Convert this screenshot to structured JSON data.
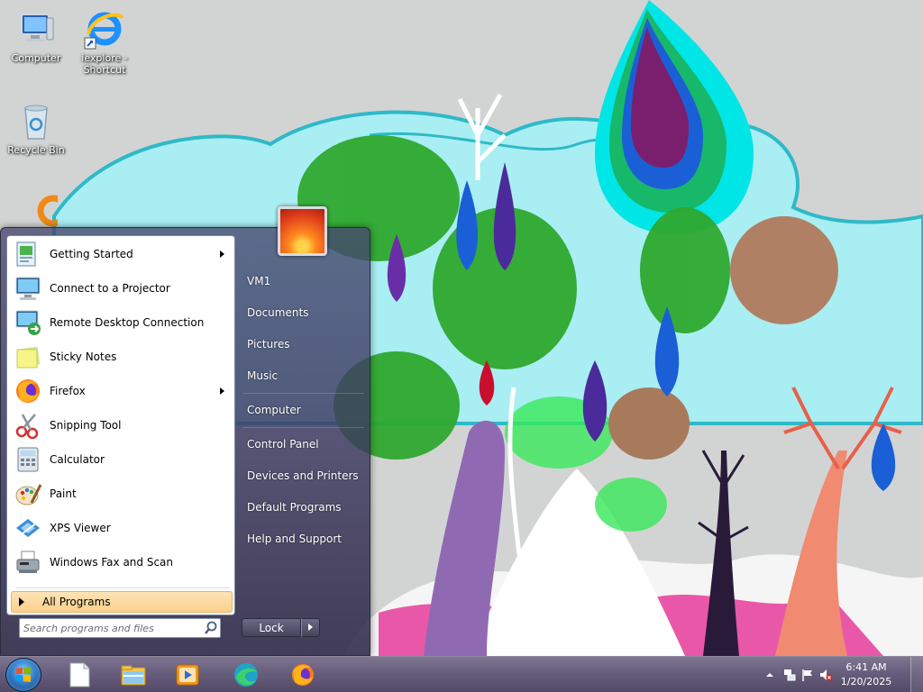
{
  "desktop": {
    "icons": [
      {
        "label": "Computer"
      },
      {
        "label": "iexplore - Shortcut"
      },
      {
        "label": "Recycle Bin"
      }
    ]
  },
  "start_menu": {
    "programs": [
      {
        "label": "Getting Started",
        "has_submenu": true
      },
      {
        "label": "Connect to a Projector",
        "has_submenu": false
      },
      {
        "label": "Remote Desktop Connection",
        "has_submenu": false
      },
      {
        "label": "Sticky Notes",
        "has_submenu": false
      },
      {
        "label": "Firefox",
        "has_submenu": true
      },
      {
        "label": "Snipping Tool",
        "has_submenu": false
      },
      {
        "label": "Calculator",
        "has_submenu": false
      },
      {
        "label": "Paint",
        "has_submenu": false
      },
      {
        "label": "XPS Viewer",
        "has_submenu": false
      },
      {
        "label": "Windows Fax and Scan",
        "has_submenu": false
      }
    ],
    "all_programs_label": "All Programs",
    "search": {
      "placeholder": "Search programs and files",
      "value": ""
    },
    "right_items": [
      "VM1",
      "Documents",
      "Pictures",
      "Music",
      "Computer",
      "Control Panel",
      "Devices and Printers",
      "Default Programs",
      "Help and Support"
    ],
    "power_button_label": "Lock"
  },
  "taskbar": {
    "pinned": [
      "notepad-icon",
      "explorer-icon",
      "media-player-icon",
      "edge-icon",
      "firefox-icon"
    ],
    "clock": {
      "time": "6:41 AM",
      "date": "1/20/2025"
    }
  }
}
